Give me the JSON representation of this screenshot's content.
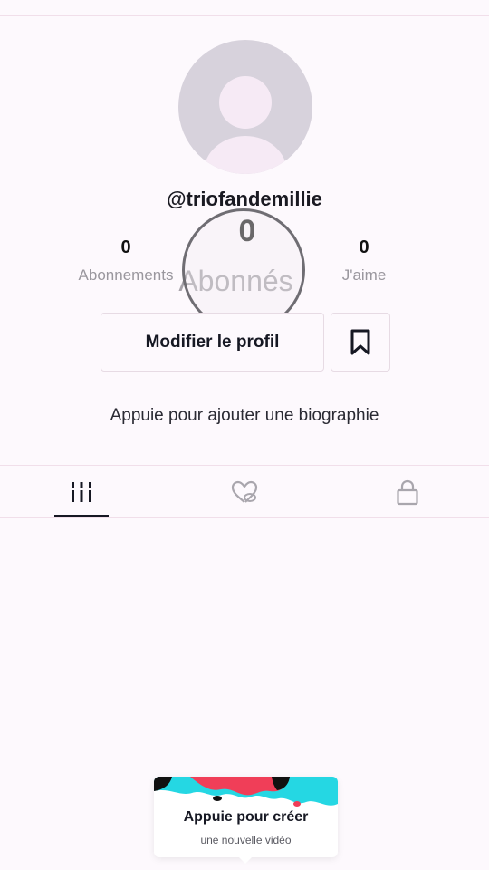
{
  "profile": {
    "username": "@triofandemillie",
    "bio_prompt": "Appuie pour ajouter une biographie"
  },
  "stats": {
    "following": {
      "value": "0",
      "label": "Abonnements"
    },
    "followers": {
      "value": "0",
      "label": "Abonnés"
    },
    "likes": {
      "value": "0",
      "label": "J'aime"
    }
  },
  "actions": {
    "edit_profile_label": "Modifier le profil",
    "bookmark_icon": "bookmark-icon"
  },
  "tabs": [
    {
      "icon": "grid-icon",
      "selected": true
    },
    {
      "icon": "liked-heart-icon",
      "selected": false
    },
    {
      "icon": "lock-icon",
      "selected": false
    }
  ],
  "create_prompt": {
    "title": "Appuie pour créer",
    "subtitle": "une nouvelle vidéo"
  },
  "colors": {
    "background": "#fdf9fd",
    "text": "#161823",
    "muted": "#9a979e",
    "splash_cyan": "#25d7e3",
    "splash_red": "#f03e58"
  }
}
